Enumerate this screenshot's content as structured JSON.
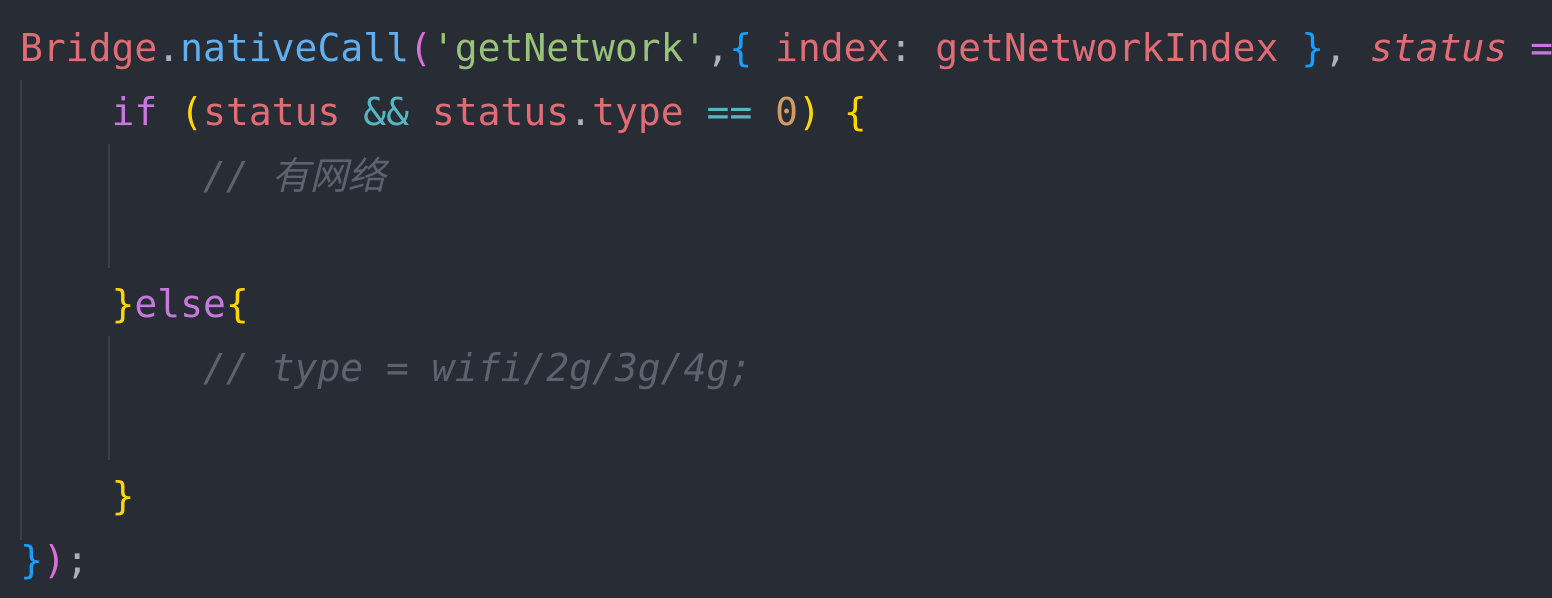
{
  "colors": {
    "background": "#282c34",
    "plain": "#abb2bf",
    "object": "#e06c75",
    "function": "#61afef",
    "string": "#98c379",
    "keyword": "#c678dd",
    "operator": "#56b6c2",
    "number": "#d19a66",
    "paren_yellow": "#ffd700",
    "paren_magenta": "#da70d6",
    "paren_blue": "#179fff",
    "comment": "#5c6370",
    "indent_guide": "#3b4048"
  },
  "code_lines": [
    [
      {
        "t": "Bridge",
        "c": "object"
      },
      {
        "t": ".",
        "c": "plain"
      },
      {
        "t": "nativeCall",
        "c": "function"
      },
      {
        "t": "(",
        "c": "paren_magenta"
      },
      {
        "t": "'getNetwork'",
        "c": "string"
      },
      {
        "t": ",",
        "c": "plain"
      },
      {
        "t": "{",
        "c": "paren_blue"
      },
      {
        "t": " index",
        "c": "object"
      },
      {
        "t": ": ",
        "c": "plain"
      },
      {
        "t": "getNetworkIndex",
        "c": "object"
      },
      {
        "t": " ",
        "c": "plain"
      },
      {
        "t": "}",
        "c": "paren_blue"
      },
      {
        "t": ", ",
        "c": "plain"
      },
      {
        "t": "status",
        "c": "object",
        "italic": true
      },
      {
        "t": " ",
        "c": "plain"
      },
      {
        "t": "=>",
        "c": "keyword"
      },
      {
        "t": " ",
        "c": "plain"
      },
      {
        "t": "{",
        "c": "paren_blue"
      }
    ],
    [
      {
        "t": "    ",
        "c": "plain"
      },
      {
        "t": "if",
        "c": "keyword"
      },
      {
        "t": " ",
        "c": "plain"
      },
      {
        "t": "(",
        "c": "paren_yellow"
      },
      {
        "t": "status",
        "c": "object"
      },
      {
        "t": " ",
        "c": "plain"
      },
      {
        "t": "&&",
        "c": "operator"
      },
      {
        "t": " ",
        "c": "plain"
      },
      {
        "t": "status",
        "c": "object"
      },
      {
        "t": ".",
        "c": "plain"
      },
      {
        "t": "type",
        "c": "object"
      },
      {
        "t": " ",
        "c": "plain"
      },
      {
        "t": "==",
        "c": "operator"
      },
      {
        "t": " ",
        "c": "plain"
      },
      {
        "t": "0",
        "c": "number"
      },
      {
        "t": ")",
        "c": "paren_yellow"
      },
      {
        "t": " ",
        "c": "plain"
      },
      {
        "t": "{",
        "c": "paren_yellow"
      }
    ],
    [
      {
        "t": "        ",
        "c": "plain"
      },
      {
        "t": "// 有网络",
        "c": "comment",
        "italic": true
      }
    ],
    [
      {
        "t": "",
        "c": "plain"
      }
    ],
    [
      {
        "t": "    ",
        "c": "plain"
      },
      {
        "t": "}",
        "c": "paren_yellow"
      },
      {
        "t": "else",
        "c": "keyword"
      },
      {
        "t": "{",
        "c": "paren_yellow"
      }
    ],
    [
      {
        "t": "        ",
        "c": "plain"
      },
      {
        "t": "// type = wifi/2g/3g/4g;",
        "c": "comment",
        "italic": true
      }
    ],
    [
      {
        "t": "",
        "c": "plain"
      }
    ],
    [
      {
        "t": "    ",
        "c": "plain"
      },
      {
        "t": "}",
        "c": "paren_yellow"
      }
    ],
    [
      {
        "t": "}",
        "c": "paren_blue"
      },
      {
        "t": ")",
        "c": "paren_magenta"
      },
      {
        "t": ";",
        "c": "plain"
      }
    ]
  ]
}
